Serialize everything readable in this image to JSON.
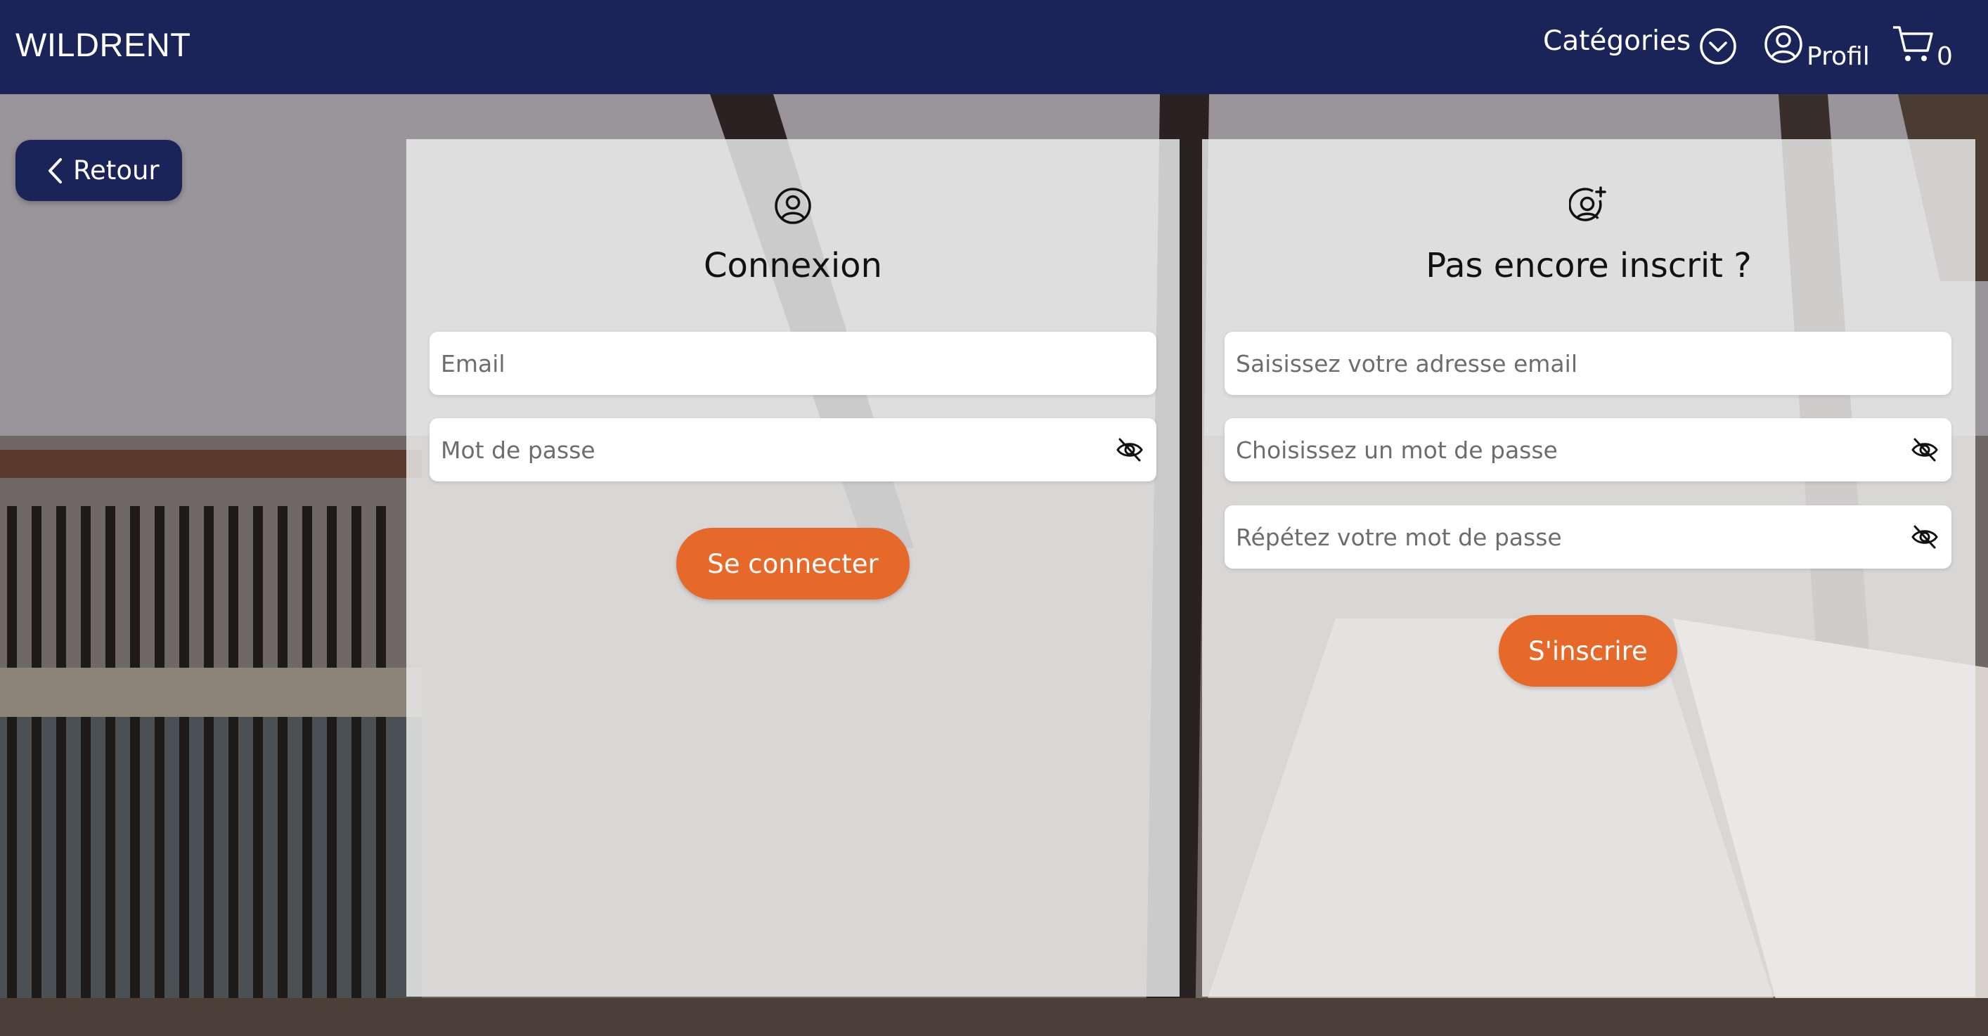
{
  "navbar": {
    "brand": "WILDRENT",
    "categories_label": "Catégories",
    "categories_icon": "chevron-down-circle-icon",
    "profile_label": "Profil",
    "profile_icon": "user-circle-icon",
    "cart_icon": "cart-icon",
    "cart_count": "0"
  },
  "back_button": {
    "label": "Retour",
    "icon": "chevron-left-icon"
  },
  "login": {
    "icon": "user-circle-icon",
    "title": "Connexion",
    "email_placeholder": "Email",
    "password_placeholder": "Mot de passe",
    "submit_label": "Se connecter"
  },
  "signup": {
    "icon": "user-plus-icon",
    "title": "Pas encore inscrit ?",
    "email_placeholder": "Saisissez votre adresse email",
    "password_placeholder": "Choisissez un mot de passe",
    "confirm_placeholder": "Répétez votre mot de passe",
    "submit_label": "S'inscrire"
  },
  "colors": {
    "navbar": "#1b2458",
    "accent": "#e7692a",
    "panel": "#ececec"
  }
}
